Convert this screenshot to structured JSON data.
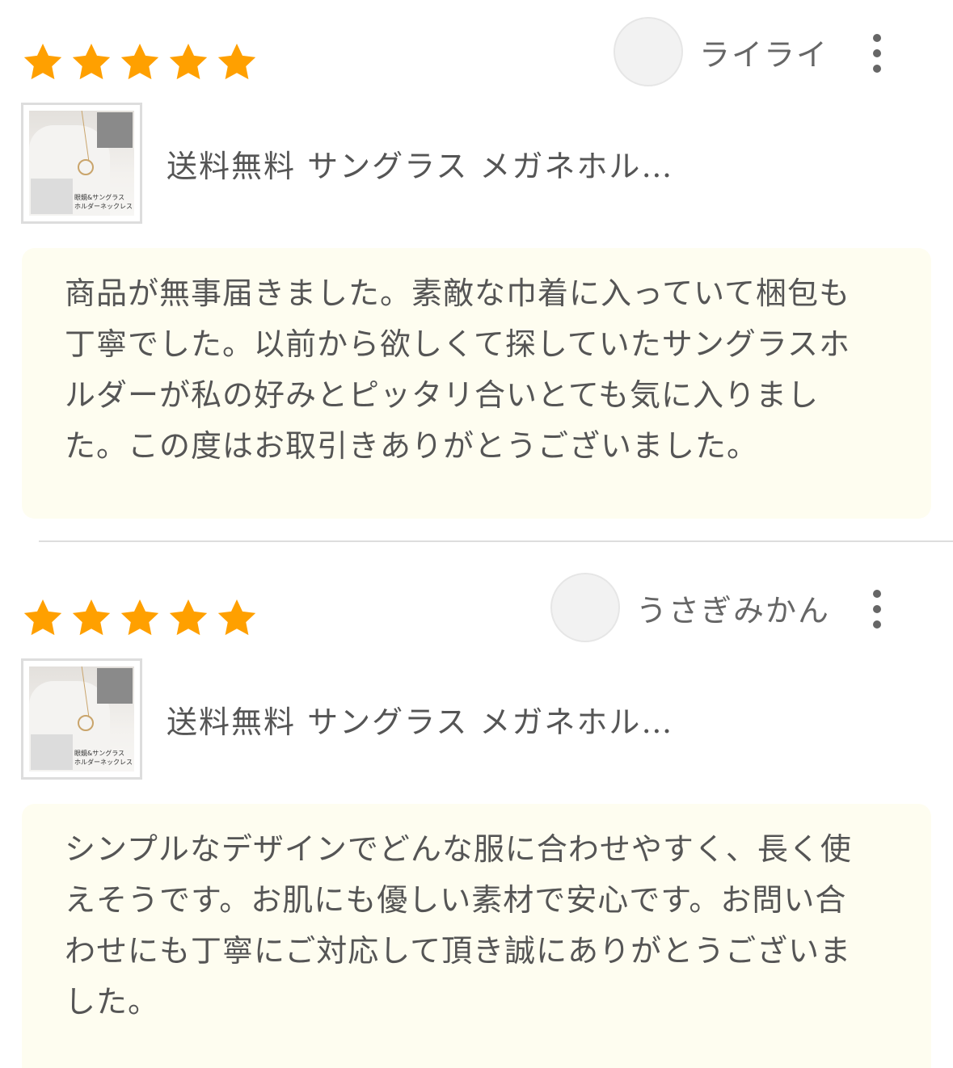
{
  "colors": {
    "star": "#ffa000",
    "comment_bg": "#fefdf0",
    "text": "#555555",
    "divider": "#dddddd"
  },
  "reviews": [
    {
      "rating": 5,
      "user": {
        "name": "ライライ",
        "avatar_icon": "avatar-placeholder"
      },
      "menu_icon": "more-vertical-icon",
      "product": {
        "title": "送料無料 サングラス メガネホル…",
        "thumbnail_caption": "眼鏡&サングラス\nホルダーネックレス"
      },
      "comment": "商品が無事届きました。素敵な巾着に入っていて梱包も丁寧でした。以前から欲しくて探していたサングラスホルダーが私の好みとピッタリ合いとても気に入りました。この度はお取引きありがとうございました。"
    },
    {
      "rating": 5,
      "user": {
        "name": "うさぎみかん",
        "avatar_icon": "avatar-placeholder"
      },
      "menu_icon": "more-vertical-icon",
      "product": {
        "title": "送料無料 サングラス メガネホル…",
        "thumbnail_caption": "眼鏡&サングラス\nホルダーネックレス"
      },
      "comment": "シンプルなデザインでどんな服に合わせやすく、長く使えそうです。お肌にも優しい素材で安心です。お問い合わせにも丁寧にご対応して頂き誠にありがとうございました。"
    }
  ]
}
